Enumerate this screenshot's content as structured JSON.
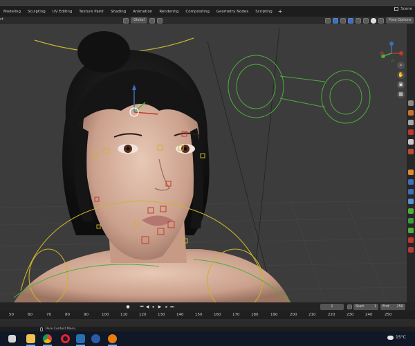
{
  "topbar": {
    "tabs": [
      "Modeling",
      "Sculpting",
      "UV Editing",
      "Texture Paint",
      "Shading",
      "Animation",
      "Rendering",
      "Compositing",
      "Geometry Nodes",
      "Scripting"
    ],
    "add_tab": "+",
    "scene_label": "Scene"
  },
  "header": {
    "left_text": "ct",
    "orientation": "Global",
    "pose_options": "Pose Options"
  },
  "timeline": {
    "current_frame": "1",
    "start_label": "Start",
    "start_value": "1",
    "end_label": "End",
    "end_value": "250",
    "ruler_ticks": [
      "50",
      "60",
      "70",
      "80",
      "90",
      "100",
      "110",
      "120",
      "130",
      "140",
      "150",
      "160",
      "170",
      "180",
      "190",
      "200",
      "210",
      "220",
      "230",
      "240",
      "250"
    ]
  },
  "statusbar": {
    "hint": "Pose Context Menu"
  },
  "taskbar": {
    "temperature": "15°C",
    "items": [
      "windows-start-icon",
      "file-explorer-icon",
      "chrome-icon",
      "opera-icon",
      "app-m-icon",
      "cinema4d-icon",
      "blender-icon"
    ]
  },
  "colors": {
    "accent_blue": "#3e6fb8",
    "rig_yellow": "#c9b330",
    "rig_green": "#4caf3a",
    "control_red": "#c0392b",
    "taskbar_bg": "#101726"
  }
}
